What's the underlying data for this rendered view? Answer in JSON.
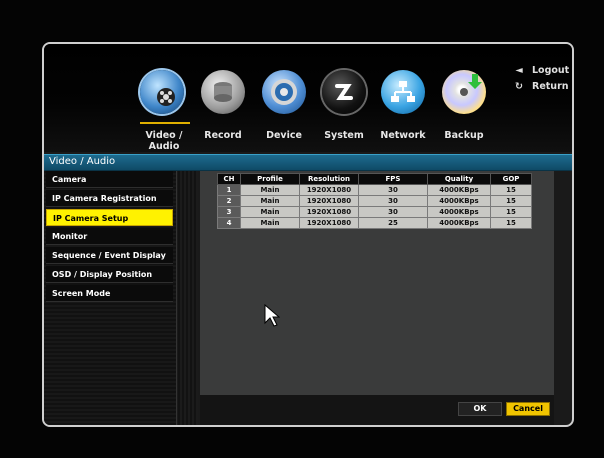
{
  "menu": {
    "items": [
      {
        "label": "Video / Audio",
        "icon": "video-audio-icon"
      },
      {
        "label": "Record",
        "icon": "record-icon"
      },
      {
        "label": "Device",
        "icon": "device-icon"
      },
      {
        "label": "System",
        "icon": "system-icon"
      },
      {
        "label": "Network",
        "icon": "network-icon"
      },
      {
        "label": "Backup",
        "icon": "backup-icon"
      }
    ],
    "logout_label": "Logout",
    "return_label": "Return"
  },
  "section_title": "Video / Audio",
  "sidebar": {
    "items": [
      {
        "label": "Camera"
      },
      {
        "label": "IP Camera Registration"
      },
      {
        "label": "IP Camera Setup",
        "active": true
      },
      {
        "label": "Monitor"
      },
      {
        "label": "Sequence / Event Display"
      },
      {
        "label": "OSD / Display Position"
      },
      {
        "label": "Screen Mode"
      }
    ]
  },
  "table": {
    "headers": [
      "CH",
      "Profile",
      "Resolution",
      "FPS",
      "Quality",
      "GOP"
    ],
    "rows": [
      [
        "1",
        "Main",
        "1920X1080",
        "30",
        "4000KBps",
        "15"
      ],
      [
        "2",
        "Main",
        "1920X1080",
        "30",
        "4000KBps",
        "15"
      ],
      [
        "3",
        "Main",
        "1920X1080",
        "30",
        "4000KBps",
        "15"
      ],
      [
        "4",
        "Main",
        "1920X1080",
        "25",
        "4000KBps",
        "15"
      ]
    ]
  },
  "buttons": {
    "ok": "OK",
    "cancel": "Cancel"
  },
  "colors": {
    "accent": "#f0c400",
    "header": "#1d6b8f",
    "content_bg": "#3a3b3b"
  }
}
